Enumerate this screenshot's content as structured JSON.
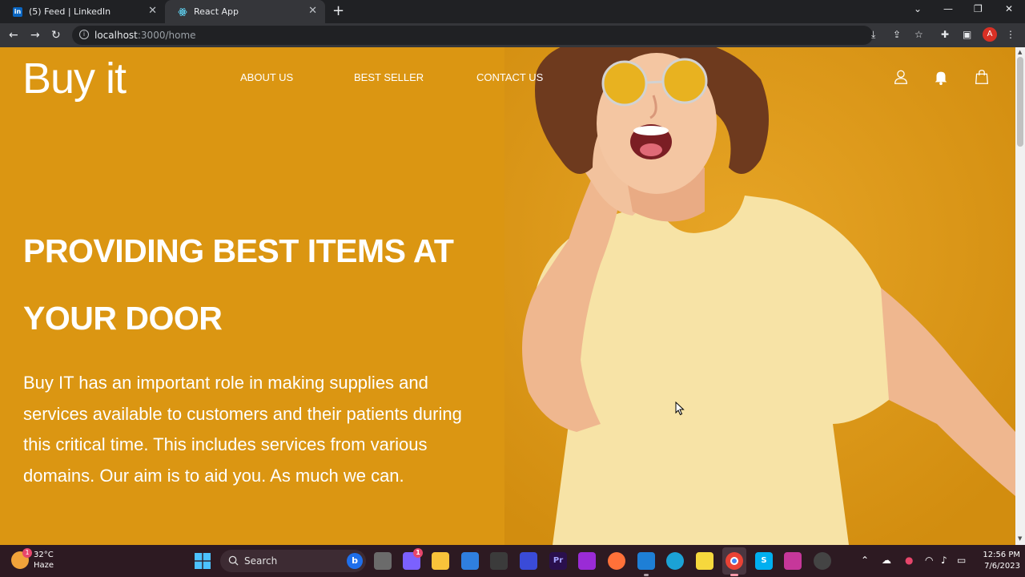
{
  "browser": {
    "tabs": [
      {
        "title": "(5) Feed | LinkedIn",
        "favicon": "in"
      },
      {
        "title": "React App",
        "favicon": "react-icon"
      }
    ],
    "new_tab": "+",
    "close_glyph": "✕",
    "address": {
      "host": "localhost",
      "path": ":3000/home"
    },
    "profile_initial": "A"
  },
  "site": {
    "brand": "Buy it",
    "nav": [
      "ABOUT US",
      "BEST SELLER",
      "CONTACT US"
    ],
    "icons": [
      "user-icon",
      "bell-icon",
      "shopping-bag-icon"
    ],
    "headline_line1": "PROVIDING BEST ITEMS AT",
    "headline_line2": "YOUR DOOR",
    "description": "Buy IT has an important role in making supplies and services available to customers and their patients during this critical time. This includes services from various domains. Our aim is to aid you. As much we can.",
    "background_color": "#db9612"
  },
  "taskbar": {
    "weather_temp": "32°C",
    "weather_desc": "Haze",
    "weather_badge": "1",
    "search_label": "Search",
    "teams_badge": "1",
    "time": "12:56 PM",
    "date": "7/6/2023"
  }
}
